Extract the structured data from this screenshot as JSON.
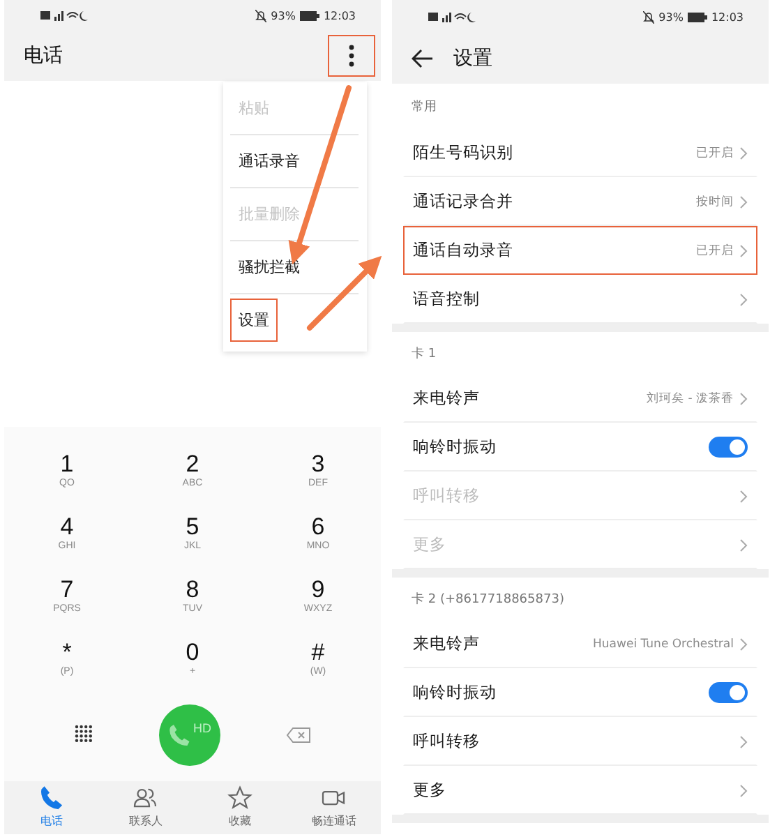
{
  "dialer": {
    "status_bar": {
      "battery": "93%",
      "time": "12:03"
    },
    "title": "电话",
    "more_button": {
      "highlighted": true
    },
    "menu": [
      {
        "label": "粘贴",
        "disabled": true,
        "highlighted": false
      },
      {
        "label": "通话录音",
        "disabled": false,
        "highlighted": false
      },
      {
        "label": "批量删除",
        "disabled": true,
        "highlighted": false
      },
      {
        "label": "骚扰拦截",
        "disabled": false,
        "highlighted": false
      },
      {
        "label": "设置",
        "disabled": false,
        "highlighted": true
      }
    ],
    "keys": [
      {
        "digit": "1",
        "letters": "QO"
      },
      {
        "digit": "2",
        "letters": "ABC"
      },
      {
        "digit": "3",
        "letters": "DEF"
      },
      {
        "digit": "4",
        "letters": "GHI"
      },
      {
        "digit": "5",
        "letters": "JKL"
      },
      {
        "digit": "6",
        "letters": "MNO"
      },
      {
        "digit": "7",
        "letters": "PQRS"
      },
      {
        "digit": "8",
        "letters": "TUV"
      },
      {
        "digit": "9",
        "letters": "WXYZ"
      },
      {
        "digit": "*",
        "letters": "(P)"
      },
      {
        "digit": "0",
        "letters": "+"
      },
      {
        "digit": "#",
        "letters": "(W)"
      }
    ],
    "call_button": {
      "label": "HD"
    },
    "tabs": [
      {
        "label": "电话",
        "selected": true
      },
      {
        "label": "联系人",
        "selected": false
      },
      {
        "label": "收藏",
        "selected": false
      },
      {
        "label": "畅连通话",
        "selected": false
      }
    ]
  },
  "settings": {
    "status_bar": {
      "battery": "93%",
      "time": "12:03"
    },
    "title": "设置",
    "sections": [
      {
        "title": "常用",
        "rows": [
          {
            "kind": "link",
            "label": "陌生号码识别",
            "value": "已开启",
            "disabled": false,
            "highlighted": false
          },
          {
            "kind": "link",
            "label": "通话记录合并",
            "value": "按时间",
            "disabled": false,
            "highlighted": false
          },
          {
            "kind": "link",
            "label": "通话自动录音",
            "value": "已开启",
            "disabled": false,
            "highlighted": true
          },
          {
            "kind": "link",
            "label": "语音控制",
            "disabled": false,
            "highlighted": false
          }
        ]
      },
      {
        "title": "卡 1",
        "rows": [
          {
            "kind": "link",
            "label": "来电铃声",
            "value": "刘珂矣 - 泼茶香",
            "disabled": false,
            "highlighted": false
          },
          {
            "kind": "toggle",
            "label": "响铃时振动",
            "on": true
          },
          {
            "kind": "link",
            "label": "呼叫转移",
            "disabled": true,
            "highlighted": false
          },
          {
            "kind": "link",
            "label": "更多",
            "disabled": true,
            "highlighted": false
          }
        ]
      },
      {
        "title": "卡 2 (+8617718865873)",
        "rows": [
          {
            "kind": "link",
            "label": "来电铃声",
            "value": "Huawei Tune Orchestral",
            "disabled": false,
            "highlighted": false
          },
          {
            "kind": "toggle",
            "label": "响铃时振动",
            "on": true
          },
          {
            "kind": "link",
            "label": "呼叫转移",
            "disabled": false,
            "highlighted": false
          },
          {
            "kind": "link",
            "label": "更多",
            "disabled": false,
            "highlighted": false
          }
        ]
      }
    ]
  }
}
